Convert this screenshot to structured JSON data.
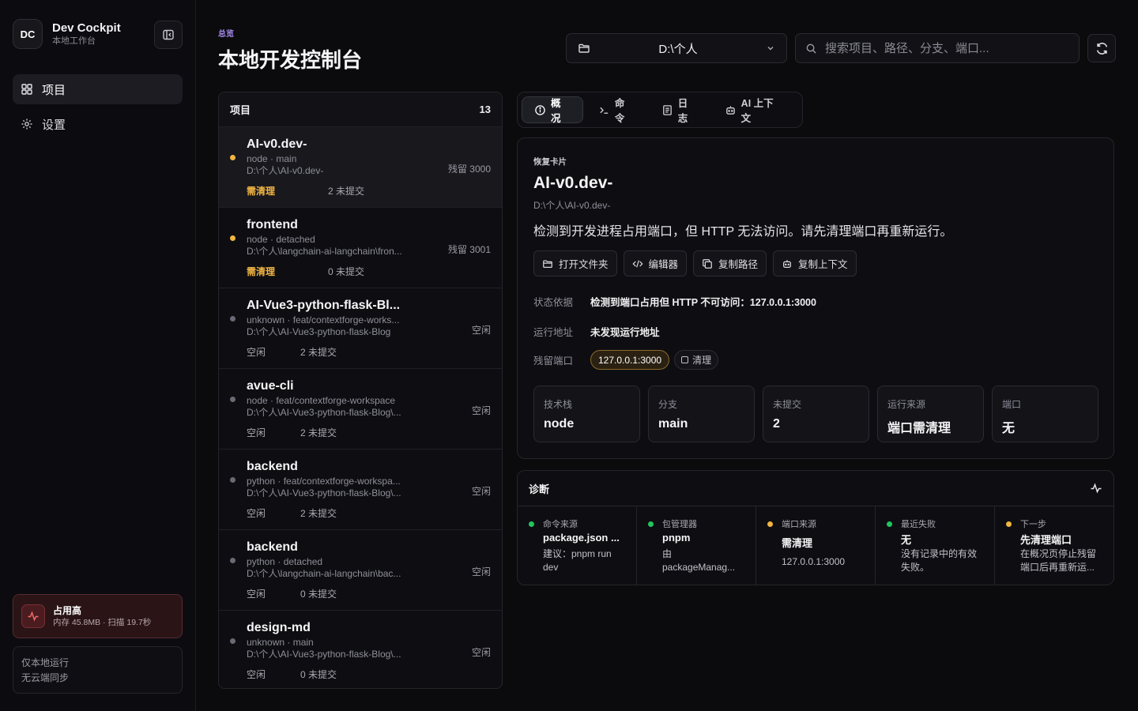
{
  "brand": {
    "logo": "DC",
    "name": "Dev Cockpit",
    "subtitle": "本地工作台"
  },
  "nav": [
    {
      "label": "项目",
      "icon": "grid-icon",
      "active": true
    },
    {
      "label": "设置",
      "icon": "gear-icon",
      "active": false
    }
  ],
  "alert": {
    "title": "占用高",
    "subtitle": "内存 45.8MB · 扫描 19.7秒"
  },
  "local_note": {
    "line1": "仅本地运行",
    "line2": "无云端同步"
  },
  "header": {
    "crumb": "总览",
    "title": "本地开发控制台"
  },
  "dir_select": {
    "value": "D:\\个人"
  },
  "search": {
    "placeholder": "搜索项目、路径、分支、端口..."
  },
  "projects": {
    "title": "项目",
    "count": "13",
    "items": [
      {
        "name": "AI-v0.dev-",
        "meta": "node · main",
        "path": "D:\\个人\\AI-v0.dev-",
        "status": "需清理",
        "uncommitted": "2 未提交",
        "side": "残留 3000",
        "dot": "#f2b544"
      },
      {
        "name": "frontend",
        "meta": "node · detached",
        "path": "D:\\个人\\langchain-ai-langchain\\fron...",
        "status": "需清理",
        "uncommitted": "0 未提交",
        "side": "残留 3001",
        "dot": "#f2b544"
      },
      {
        "name": "AI-Vue3-python-flask-Bl...",
        "meta": "unknown · feat/contextforge-works...",
        "path": "D:\\个人\\AI-Vue3-python-flask-Blog",
        "status": "空闲",
        "uncommitted": "2 未提交",
        "side": "空闲",
        "dot": "#6a6a74"
      },
      {
        "name": "avue-cli",
        "meta": "node · feat/contextforge-workspace",
        "path": "D:\\个人\\AI-Vue3-python-flask-Blog\\...",
        "status": "空闲",
        "uncommitted": "2 未提交",
        "side": "空闲",
        "dot": "#6a6a74"
      },
      {
        "name": "backend",
        "meta": "python · feat/contextforge-workspa...",
        "path": "D:\\个人\\AI-Vue3-python-flask-Blog\\...",
        "status": "空闲",
        "uncommitted": "2 未提交",
        "side": "空闲",
        "dot": "#6a6a74"
      },
      {
        "name": "backend",
        "meta": "python · detached",
        "path": "D:\\个人\\langchain-ai-langchain\\bac...",
        "status": "空闲",
        "uncommitted": "0 未提交",
        "side": "空闲",
        "dot": "#6a6a74"
      },
      {
        "name": "design-md",
        "meta": "unknown · main",
        "path": "D:\\个人\\AI-Vue3-python-flask-Blog\\...",
        "status": "空闲",
        "uncommitted": "0 未提交",
        "side": "空闲",
        "dot": "#6a6a74"
      }
    ]
  },
  "tabs": [
    {
      "label": "概况",
      "icon": "info-icon",
      "active": true
    },
    {
      "label": "命令",
      "icon": "terminal-icon",
      "active": false
    },
    {
      "label": "日志",
      "icon": "log-icon",
      "active": false
    },
    {
      "label": "AI 上下文",
      "icon": "bot-icon",
      "active": false
    }
  ],
  "card": {
    "label": "恢复卡片",
    "title": "AI-v0.dev-",
    "path": "D:\\个人\\AI-v0.dev-",
    "message": "检测到开发进程占用端口，但 HTTP 无法访问。请先清理端口再重新运行。",
    "actions": [
      {
        "label": "打开文件夹",
        "icon": "folder-icon"
      },
      {
        "label": "编辑器",
        "icon": "code-icon"
      },
      {
        "label": "复制路径",
        "icon": "copy-icon"
      },
      {
        "label": "复制上下文",
        "icon": "bot-icon"
      }
    ],
    "status_basis": {
      "key": "状态依据",
      "value": "检测到端口占用但 HTTP 不可访问：127.0.0.1:3000"
    },
    "run_address": {
      "key": "运行地址",
      "value": "未发现运行地址"
    },
    "residual_port": {
      "key": "残留端口",
      "port": "127.0.0.1:3000",
      "clean": "清理"
    },
    "stats": [
      {
        "label": "技术栈",
        "value": "node"
      },
      {
        "label": "分支",
        "value": "main"
      },
      {
        "label": "未提交",
        "value": "2"
      },
      {
        "label": "运行来源",
        "value": "端口需清理"
      },
      {
        "label": "端口",
        "value": "无"
      }
    ]
  },
  "diagnostics": {
    "title": "诊断",
    "items": [
      {
        "label": "命令来源",
        "value": "package.json ...",
        "desc1": "建议：pnpm run",
        "desc2": "dev",
        "dot": "#22c55e"
      },
      {
        "label": "包管理器",
        "value": "pnpm",
        "desc1": "由",
        "desc2": "packageManag...",
        "dot": "#22c55e"
      },
      {
        "label": "端口来源",
        "value": "需清理",
        "desc1": "127.0.0.1:3000",
        "desc2": "",
        "dot": "#f2b544"
      },
      {
        "label": "最近失败",
        "value": "无",
        "desc1": "没有记录中的有效",
        "desc2": "失败。",
        "dot": "#22c55e"
      },
      {
        "label": "下一步",
        "value": "先清理端口",
        "desc1": "在概况页停止残留",
        "desc2": "端口后再重新运...",
        "dot": "#f2b544"
      }
    ]
  }
}
